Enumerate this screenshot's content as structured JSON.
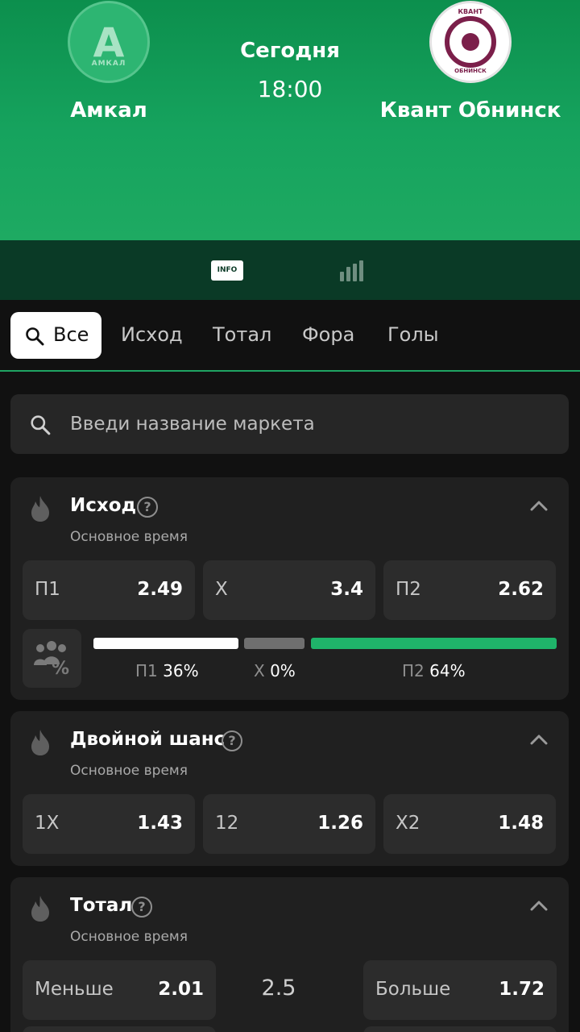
{
  "match": {
    "team1": "Амкал",
    "team1_logo_text": "АМКАЛ",
    "team2": "Квант Обнинск",
    "team2_logo_top": "КВАНТ",
    "team2_logo_bottom": "ОБНИНСК",
    "day": "Сегодня",
    "time": "18:00"
  },
  "info_bar": {
    "info_badge": "INFO",
    "icons": [
      "info-icon",
      "stats-bars-icon"
    ]
  },
  "tabs": {
    "active": "Все",
    "items": [
      "Исход",
      "Тотал",
      "Фора",
      "Голы"
    ]
  },
  "search": {
    "placeholder": "Введи название маркета"
  },
  "markets": [
    {
      "title": "Исход",
      "subtitle": "Основное время",
      "odds": [
        {
          "label": "П1",
          "value": "2.49"
        },
        {
          "label": "Х",
          "value": "3.4"
        },
        {
          "label": "П2",
          "value": "2.62"
        }
      ],
      "bets_split": [
        {
          "label": "П1",
          "pct": "36%",
          "share": 0.36,
          "color": "#ffffff"
        },
        {
          "label": "Х",
          "pct": "0%",
          "share": 0.0,
          "color": "#6f6f6f"
        },
        {
          "label": "П2",
          "pct": "64%",
          "share": 0.64,
          "color": "#1fb46a"
        }
      ]
    },
    {
      "title": "Двойной шанс",
      "subtitle": "Основное время",
      "odds": [
        {
          "label": "1Х",
          "value": "1.43"
        },
        {
          "label": "12",
          "value": "1.26"
        },
        {
          "label": "Х2",
          "value": "1.48"
        }
      ]
    },
    {
      "title": "Тотал",
      "subtitle": "Основное время",
      "line": "2.5",
      "odds": [
        {
          "label": "Меньше",
          "value": "2.01"
        },
        {
          "label": "Больше",
          "value": "1.72"
        }
      ]
    }
  ],
  "colors": {
    "accent": "#1fa463",
    "header_green": "#16a35e",
    "card_bg": "#202020"
  }
}
